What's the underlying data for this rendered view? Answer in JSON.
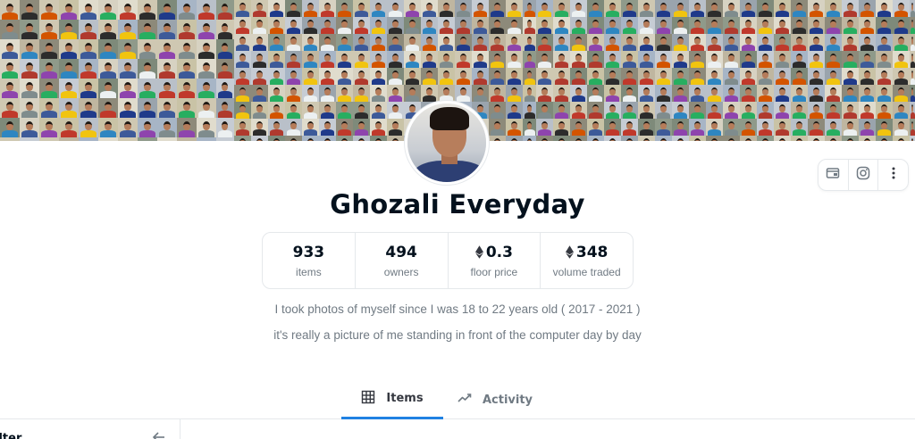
{
  "collection": {
    "name": "Ghozali Everyday",
    "stats": [
      {
        "value": "933",
        "label": "items",
        "eth": false
      },
      {
        "value": "494",
        "label": "owners",
        "eth": false
      },
      {
        "value": "0.3",
        "label": "floor price",
        "eth": true
      },
      {
        "value": "348",
        "label": "volume traded",
        "eth": true
      }
    ],
    "description": [
      "I took photos of myself since I was 18 to 22 years old ( 2017 - 2021 )",
      "it's really a picture of me standing in front of the computer day by day"
    ]
  },
  "actions": [
    {
      "icon": "website-icon"
    },
    {
      "icon": "instagram-icon"
    },
    {
      "icon": "more-options-icon"
    }
  ],
  "tabs": [
    {
      "label": "Items",
      "icon": "grid-icon",
      "active": true
    },
    {
      "label": "Activity",
      "icon": "activity-icon",
      "active": false
    }
  ],
  "sidebar": {
    "label": "ilter",
    "collapse_icon": "arrow-left-icon"
  },
  "colors": {
    "accent": "#2081e2",
    "text_primary": "#04111d",
    "text_secondary": "#707a83",
    "border": "#e5e8eb"
  }
}
